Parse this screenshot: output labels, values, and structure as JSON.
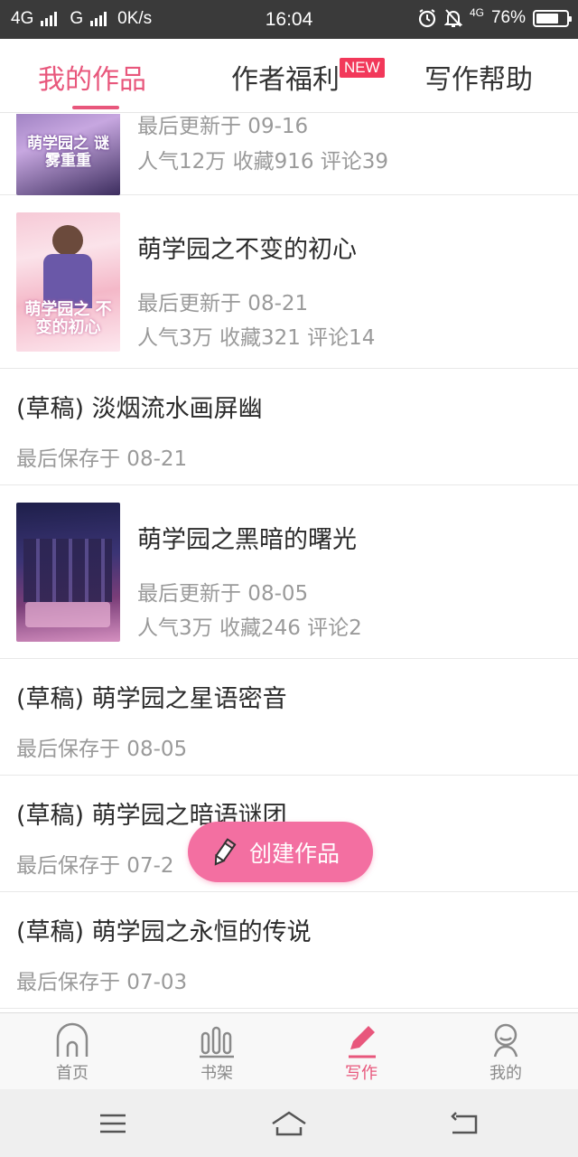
{
  "status_bar": {
    "network": "4G",
    "network2": "G",
    "speed": "0K/s",
    "time": "16:04",
    "network_right": "4G",
    "battery": "76%",
    "battery_level": 0.76
  },
  "tabs": [
    {
      "label": "我的作品",
      "active": true
    },
    {
      "label": "作者福利",
      "badge": "NEW"
    },
    {
      "label": "写作帮助"
    }
  ],
  "works": [
    {
      "type": "published",
      "cover_text": "萌学园之 谜雾重重",
      "updated": "最后更新于 09-16",
      "stats": "人气12万 收藏916 评论39"
    },
    {
      "type": "published",
      "title": "萌学园之不变的初心",
      "cover_text": "萌学园之 不变的初心",
      "updated": "最后更新于 08-21",
      "stats": "人气3万 收藏321 评论14"
    },
    {
      "type": "draft",
      "title": "(草稿) 淡烟流水画屏幽",
      "saved": "最后保存于 08-21"
    },
    {
      "type": "published",
      "title": "萌学园之黑暗的曙光",
      "updated": "最后更新于 08-05",
      "stats": "人气3万 收藏246 评论2"
    },
    {
      "type": "draft",
      "title": "(草稿) 萌学园之星语密音",
      "saved": "最后保存于 08-05"
    },
    {
      "type": "draft",
      "title": "(草稿) 萌学园之暗语谜团",
      "saved": "最后保存于 07-2"
    },
    {
      "type": "draft",
      "title": "(草稿) 萌学园之永恒的传说",
      "saved": "最后保存于 07-03"
    }
  ],
  "fab": {
    "label": "创建作品"
  },
  "bottom_nav": [
    {
      "label": "首页",
      "icon": "home-icon"
    },
    {
      "label": "书架",
      "icon": "bookshelf-icon"
    },
    {
      "label": "写作",
      "icon": "pencil-icon",
      "active": true
    },
    {
      "label": "我的",
      "icon": "profile-icon"
    }
  ],
  "system_nav": [
    "menu-icon",
    "home-icon",
    "back-icon"
  ],
  "colors": {
    "accent": "#e8577c",
    "fab": "#f36fa1",
    "badge": "#f2385a"
  }
}
